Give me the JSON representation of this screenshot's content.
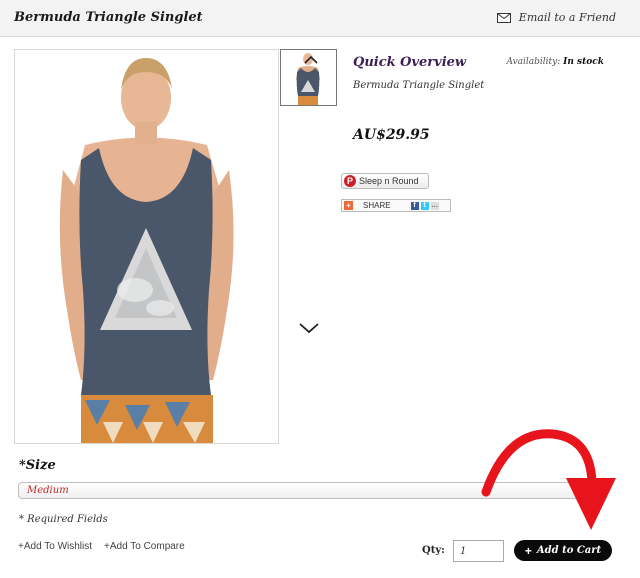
{
  "header": {
    "product_title": "Bermuda Triangle Singlet",
    "email_friend_label": "Email to a Friend"
  },
  "gallery": {
    "main_image_alt": "Bermuda Triangle Singlet",
    "up_icon": "chevron-up-icon",
    "down_icon": "chevron-down-icon"
  },
  "overview": {
    "title": "Quick Overview",
    "availability_label": "Availability:",
    "availability_value": "In stock",
    "product_name": "Bermuda Triangle Singlet",
    "price": "AU$29.95"
  },
  "social": {
    "pin_label": "Sleep n Round",
    "share_label": "SHARE"
  },
  "options": {
    "size_label": "*Size",
    "size_value": "Medium"
  },
  "footer": {
    "required_note": "* Required Fields",
    "wishlist_label": "Add To Wishlist",
    "compare_label": "Add To Compare",
    "qty_label": "Qty:",
    "qty_value": "1",
    "add_to_cart_label": "Add to Cart"
  },
  "colors": {
    "accent_purple": "#3c1f52",
    "size_red": "#c0272d",
    "button_black": "#0a0a0a",
    "annotation_red": "#e8141c"
  }
}
